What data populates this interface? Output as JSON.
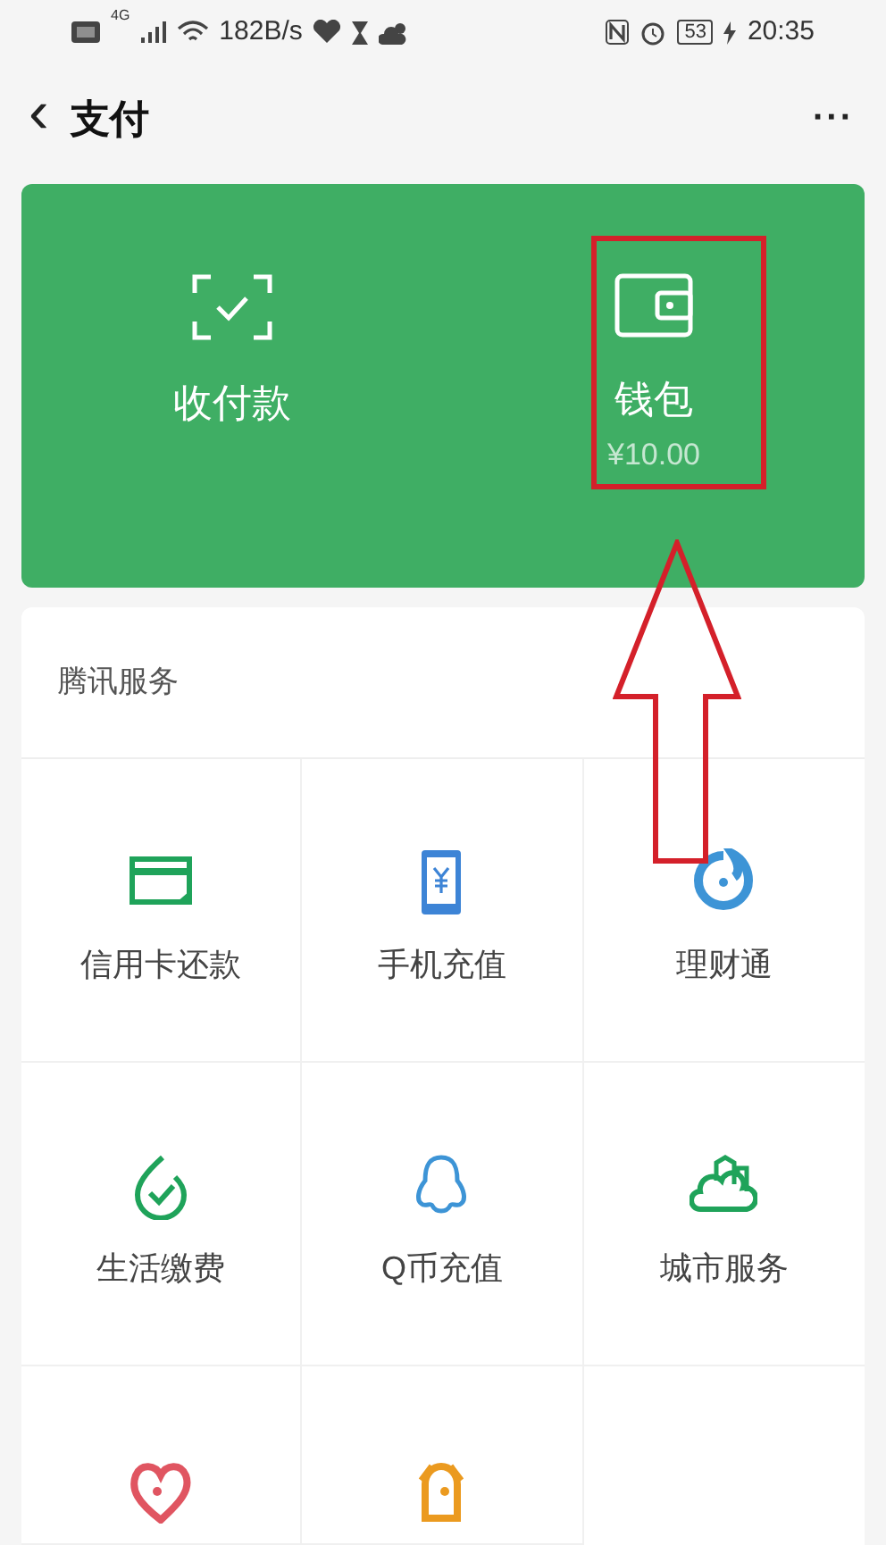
{
  "status_bar": {
    "network": "4G",
    "speed": "182B/s",
    "battery": "53",
    "time": "20:35"
  },
  "header": {
    "back": "‹",
    "title": "支付",
    "more": "···"
  },
  "top_card": [
    {
      "kind": "scan",
      "label": "收付款"
    },
    {
      "kind": "wallet",
      "label": "钱包",
      "amount": "¥10.00"
    }
  ],
  "services": {
    "title": "腾讯服务",
    "items": [
      {
        "kind": "card",
        "label": "信用卡还款"
      },
      {
        "kind": "phone",
        "label": "手机充值"
      },
      {
        "kind": "fund",
        "label": "理财通"
      },
      {
        "kind": "bill",
        "label": "生活缴费"
      },
      {
        "kind": "qq",
        "label": "Q币充值"
      },
      {
        "kind": "city",
        "label": "城市服务"
      },
      {
        "kind": "heart"
      },
      {
        "kind": "bear"
      }
    ]
  }
}
